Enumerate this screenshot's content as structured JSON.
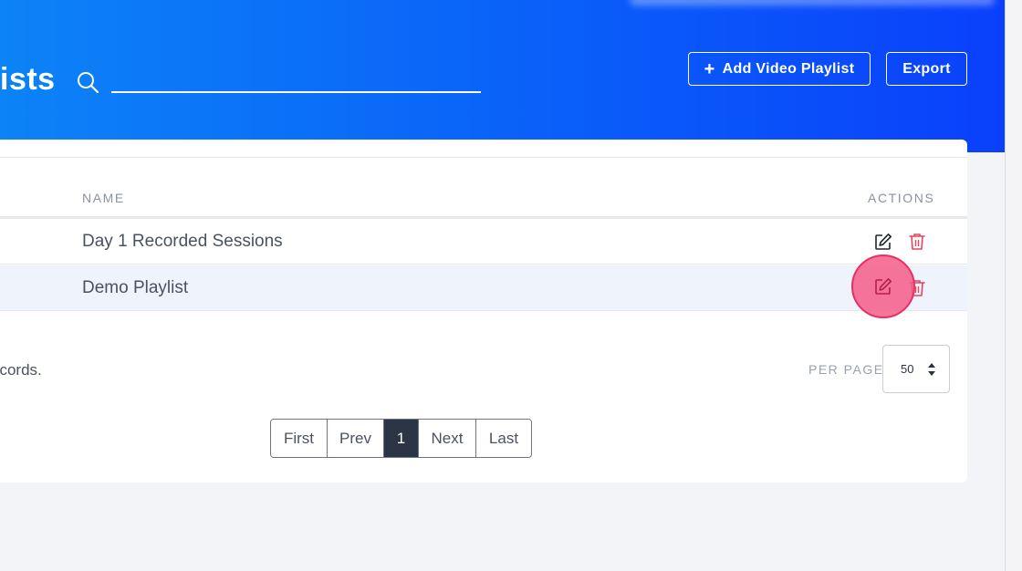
{
  "header": {
    "title": "ists",
    "search": {
      "value": "",
      "placeholder": ""
    },
    "add_button_label": "Add Video Playlist",
    "add_button_icon": "plus-icon",
    "export_button_label": "Export"
  },
  "table": {
    "columns": [
      "NAME",
      "ACTIONS"
    ],
    "rows": [
      {
        "name": "Day 1 Recorded Sessions"
      },
      {
        "name": "Demo Playlist"
      }
    ]
  },
  "footer": {
    "records_text": "ecords.",
    "per_page_label": "PER PAGE",
    "per_page_value": "50"
  },
  "pagination": {
    "first": "First",
    "prev": "Prev",
    "current": "1",
    "next": "Next",
    "last": "Last"
  },
  "colors": {
    "header_gradient_start": "#0c83f7",
    "header_gradient_end": "#0a40fb",
    "delete_icon": "#e2475a",
    "highlight": "#f65c88",
    "active_page": "#2b3546"
  }
}
